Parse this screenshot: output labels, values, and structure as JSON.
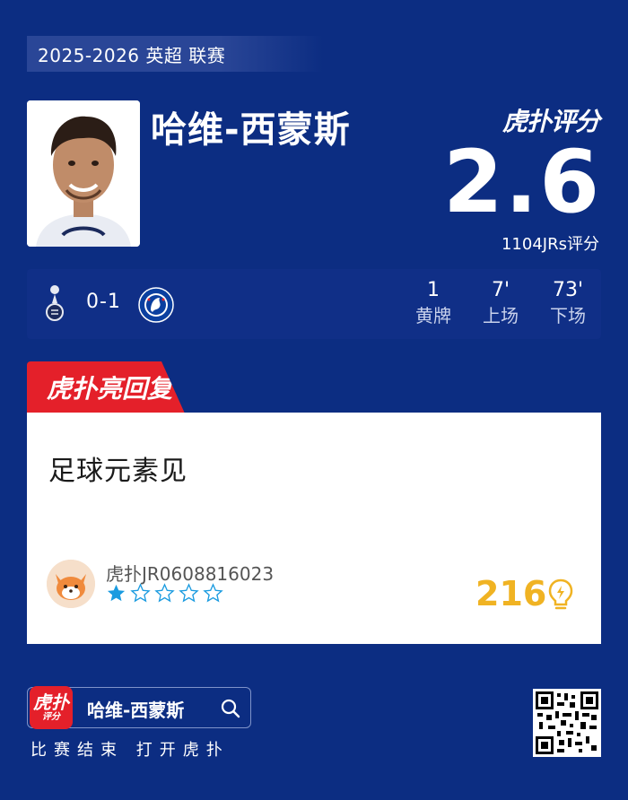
{
  "season": "2025-2026 英超 联赛",
  "player": {
    "name": "哈维-西蒙斯"
  },
  "brand": {
    "logo_text": "虎扑评分"
  },
  "rating": {
    "score": "2.6",
    "count_label": "1104JRs评分"
  },
  "match": {
    "home_team_icon": "tottenham-crest-icon",
    "score": "0-1",
    "away_team_icon": "chelsea-crest-icon",
    "stats": [
      {
        "value": "1",
        "label": "黄牌"
      },
      {
        "value": "7'",
        "label": "上场"
      },
      {
        "value": "73'",
        "label": "下场"
      }
    ]
  },
  "highlight": {
    "tab_label": "虎扑亮回复"
  },
  "comment": {
    "text": "足球元素见",
    "user": "虎扑JR0608816023",
    "stars_filled": 1,
    "stars_total": 5,
    "likes": "216",
    "colors": {
      "like": "#f0b323",
      "star_filled": "#1a9be0",
      "star_empty": "#1a9be0"
    }
  },
  "footer": {
    "app_icon_big": "虎扑",
    "app_icon_small": "评分",
    "search_term": "哈维-西蒙斯",
    "caption": "比赛结束 打开虎扑"
  },
  "colors": {
    "background": "#0c2d82",
    "accent_red": "#e4202a"
  }
}
